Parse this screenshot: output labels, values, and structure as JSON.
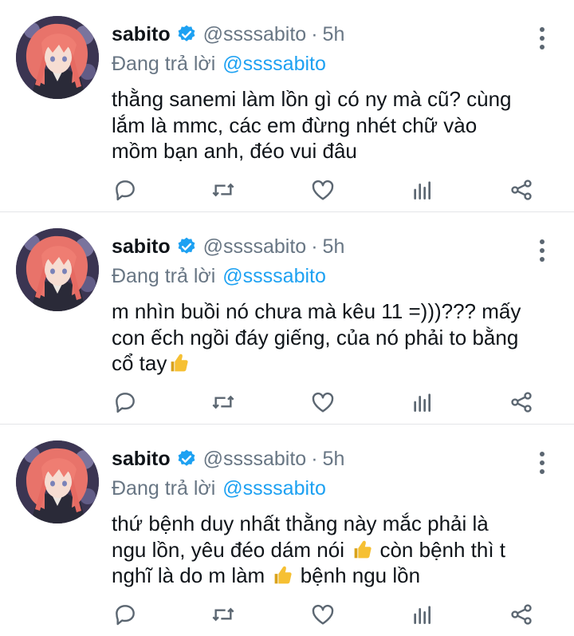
{
  "tweets": [
    {
      "author": {
        "name": "sabito",
        "handle": "@ssssabito",
        "time": "5h",
        "verified": true
      },
      "reply_prefix": "Đang trả lời",
      "reply_to": "@ssssabito",
      "lines": [
        "thằng sanemi làm lồn gì có ny mà cũ? cùng",
        "lắm là mmc, các em đừng nhét chữ vào",
        "mồm bạn anh, đéo vui đâu"
      ]
    },
    {
      "author": {
        "name": "sabito",
        "handle": "@ssssabito",
        "time": "5h",
        "verified": true
      },
      "reply_prefix": "Đang trả lời",
      "reply_to": "@ssssabito",
      "lines": [
        "m nhìn buồi nó chưa mà kêu 11 =)))??? mấy",
        "con ếch ngồi đáy giếng, của nó phải to bằng",
        "cổ tay"
      ]
    },
    {
      "author": {
        "name": "sabito",
        "handle": "@ssssabito",
        "time": "5h",
        "verified": true
      },
      "reply_prefix": "Đang trả lời",
      "reply_to": "@ssssabito",
      "lines": [
        "thứ bệnh duy nhất thằng này mắc phải là",
        "ngu lồn, yêu đéo dám nói",
        "còn bệnh thì t",
        "nghĩ là do m làm",
        "bệnh ngu lồn"
      ]
    }
  ],
  "icons": {
    "reply": "reply-icon",
    "retweet": "retweet-icon",
    "like": "heart-icon",
    "views": "analytics-icon",
    "share": "share-icon",
    "more": "more-vertical-icon",
    "verified": "verified-badge-icon",
    "emoji": "thumbs-up-emoji"
  },
  "colors": {
    "accent": "#1da1f2",
    "muted": "#687684",
    "text": "#0f1419",
    "icon": "#5b6671"
  }
}
